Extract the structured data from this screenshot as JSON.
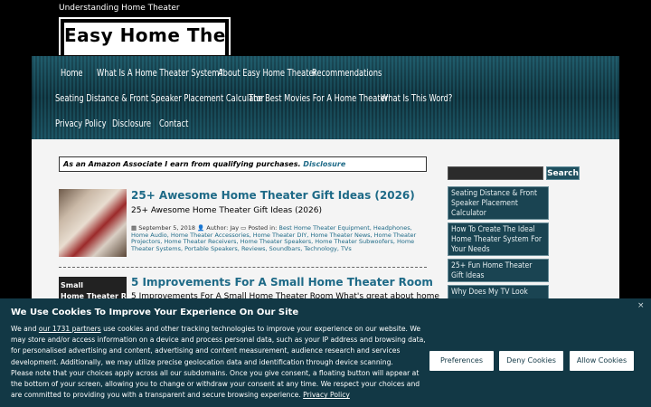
{
  "site": {
    "tagline": "Understanding Home Theater",
    "logo_text": "Easy Home Theater"
  },
  "nav": {
    "items": [
      "Home",
      "What Is A Home Theater System?",
      "About Easy Home Theater",
      "Recommendations",
      "Seating Distance & Front Speaker Placement Calculator",
      "The Best Movies For A Home Theater",
      "What Is This Word?",
      "Privacy Policy",
      "Disclosure",
      "Contact"
    ]
  },
  "amazon_notice": {
    "text": "As an Amazon Associate I earn from qualifying purchases.",
    "link": "Disclosure"
  },
  "posts": [
    {
      "title": "25+ Awesome Home Theater Gift Ideas (2026)",
      "excerpt": "25+ Awesome Home Theater Gift Ideas (2026)",
      "date": "September 5, 2018",
      "author_label": "Author: Jay",
      "posted_in_label": "Posted in:",
      "categories": "Best Home Theater Equipment, Headphones, Home Audio, Home Theater Accessories, Home Theater DIY, Home Theater News, Home Theater Projectors, Home Theater Receivers, Home Theater Speakers, Home Theater Subwoofers, Home Theater Systems, Portable Speakers, Reviews, Soundbars, Technology, TVs"
    },
    {
      "title": "5 Improvements For A Small Home Theater Room",
      "excerpt": "5 Improvements For A Small Home Theater Room What's great about home",
      "thumb_text_1": "Small",
      "thumb_text_2": "Home Theater Room"
    }
  ],
  "sidebar": {
    "search_button": "Search",
    "items": [
      "Seating Distance & Front Speaker Placement Calculator",
      "How To Create The Ideal Home Theater System For Your Needs",
      "25+ Fun Home Theater Gift Ideas",
      "Why Does My TV Look"
    ]
  },
  "cookie": {
    "title": "We Use Cookies To Improve Your Experience On Our Site",
    "close": "×",
    "text_1": "We and",
    "partners_link": "our 1731 partners",
    "text_2": "use cookies and other tracking technologies to improve your experience on our website. We may store and/or access information on a device and process personal data, such as your IP address and browsing data, for personalised advertising and content, advertising and content measurement, audience research and services development. Additionally, we may utilize precise geolocation data and identification through device scanning.",
    "text_3": "Please note that your choices apply across all our subdomains. Once you give consent, a floating button will appear at the bottom of your screen, allowing you to change or withdraw your consent at any time. We respect your choices and are committed to providing you with a transparent and secure browsing experience.",
    "privacy_link": "Privacy Policy",
    "buttons": {
      "preferences": "Preferences",
      "deny": "Deny Cookies",
      "allow": "Allow Cookies"
    }
  }
}
